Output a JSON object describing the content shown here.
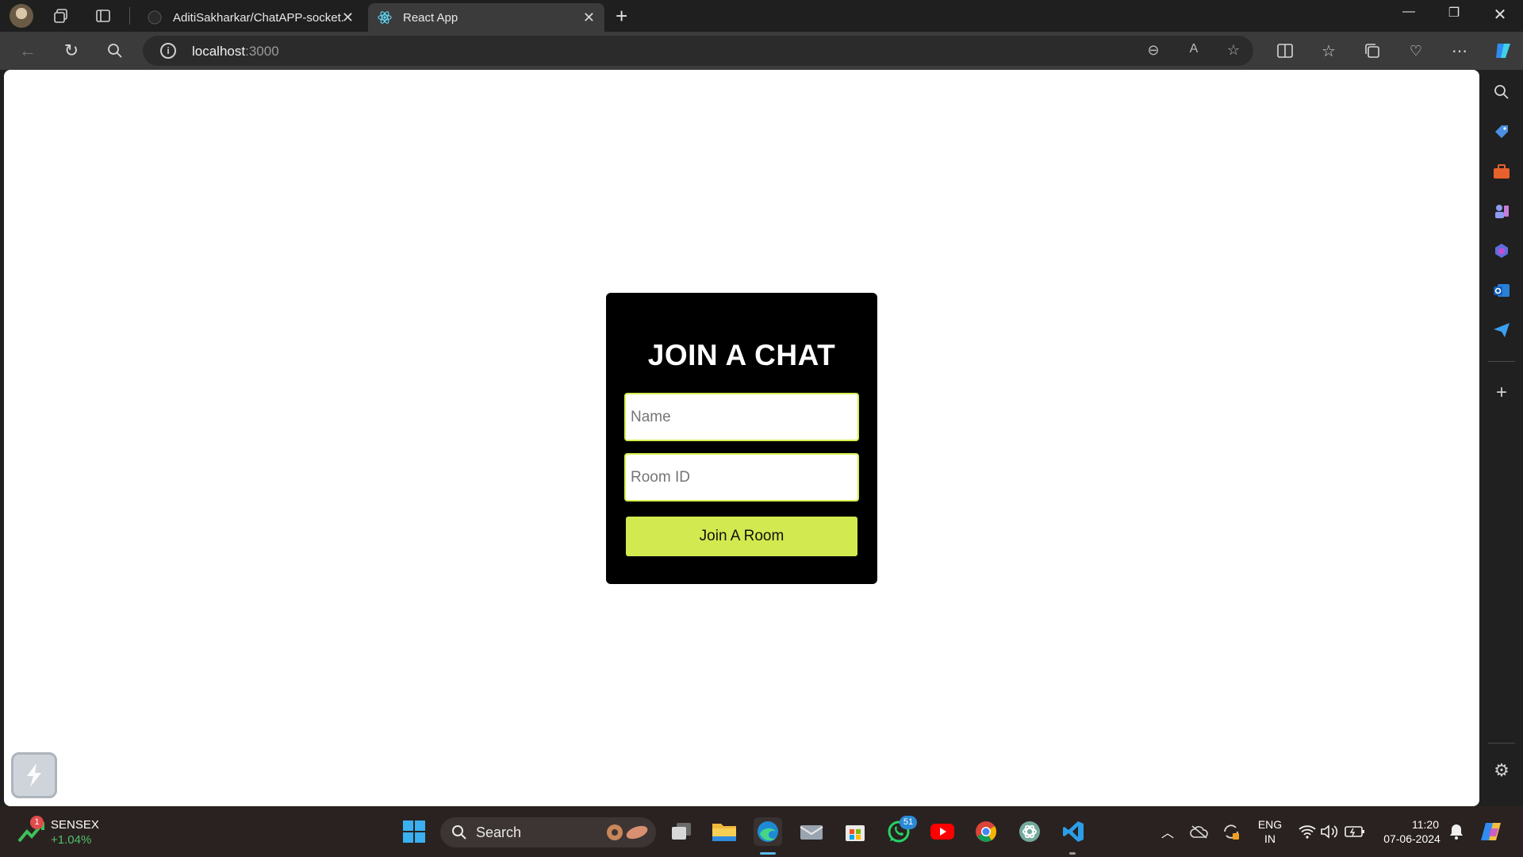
{
  "browser": {
    "tabs": [
      {
        "title": "AditiSakharkar/ChatAPP-socket.io",
        "favicon": "github-icon",
        "active": false
      },
      {
        "title": "React App",
        "favicon": "react-icon",
        "active": true
      }
    ],
    "address": {
      "host": "localhost",
      "port": ":3000"
    }
  },
  "page": {
    "heading": "JOIN A CHAT",
    "name_placeholder": "Name",
    "room_placeholder": "Room ID",
    "join_button": "Join A Room",
    "accent_color": "#d2ea4f"
  },
  "taskbar": {
    "widget": {
      "name": "SENSEX",
      "change": "+1.04%",
      "badge": "1"
    },
    "search_label": "Search",
    "whatsapp_badge": "51",
    "language": {
      "line1": "ENG",
      "line2": "IN"
    },
    "clock": {
      "time": "11:20",
      "date": "07-06-2024"
    }
  }
}
